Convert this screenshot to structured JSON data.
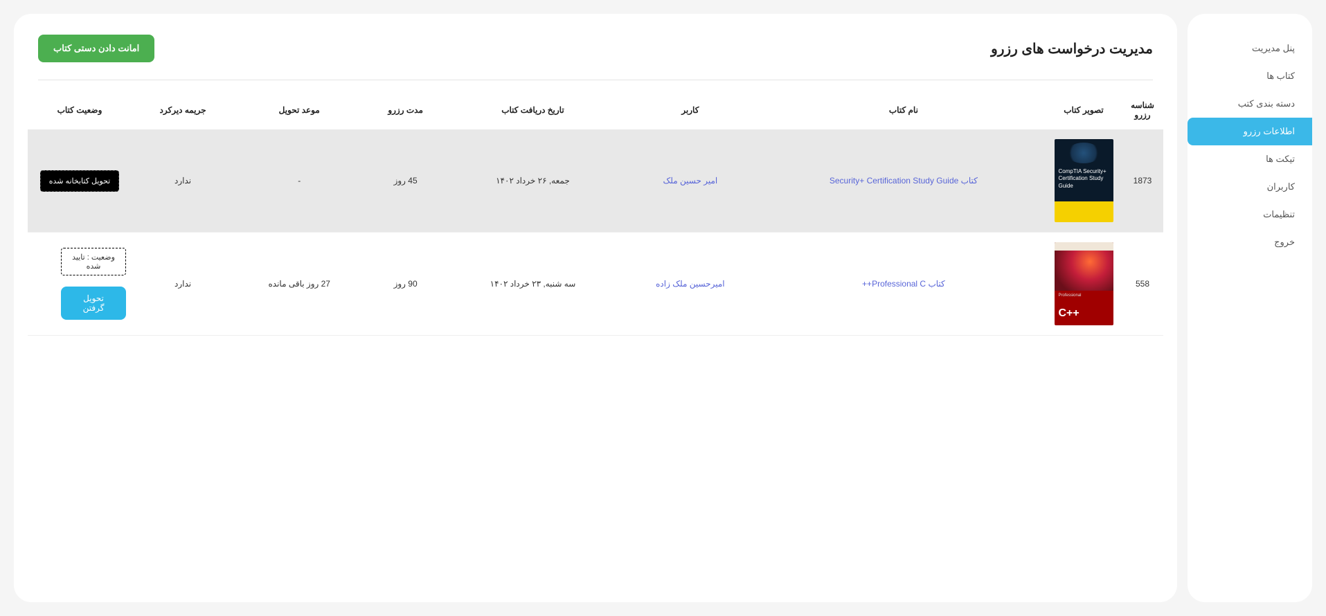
{
  "sidebar": {
    "items": [
      {
        "label": "پنل مدیریت",
        "active": false
      },
      {
        "label": "کتاب ها",
        "active": false
      },
      {
        "label": "دسته بندی کتب",
        "active": false
      },
      {
        "label": "اطلاعات رزرو",
        "active": true
      },
      {
        "label": "تیکت ها",
        "active": false
      },
      {
        "label": "کاربران",
        "active": false
      },
      {
        "label": "تنظیمات",
        "active": false
      },
      {
        "label": "خروج",
        "active": false
      }
    ]
  },
  "header": {
    "title": "مدیریت درخواست های رزرو",
    "manual_lend_label": "امانت دادن دستی کتاب"
  },
  "table": {
    "columns": {
      "reserve_id": "شناسه رزرو",
      "book_image": "تصویر کتاب",
      "book_name": "نام کتاب",
      "user": "کاربر",
      "receive_date": "تاریخ دریافت کتاب",
      "reserve_duration": "مدت رزرو",
      "due_date": "موعد تحویل",
      "late_fee": "جریمه دیرکرد",
      "status": "وضعیت کتاب"
    },
    "rows": [
      {
        "id": "1873",
        "cover_title": "CompTIA Security+ Certification Study Guide",
        "book_name": "کتاب Security+ Certification Study Guide",
        "user": "امیر حسین ملک",
        "receive_date": "جمعه, ۲۶ خرداد ۱۴۰۲",
        "duration": "45 روز",
        "due": "-",
        "late_fee": "ندارد",
        "status_label": "تحویل کتابخانه شده"
      },
      {
        "id": "558",
        "cover_title": "C++",
        "cover_sub": "Professional",
        "book_name": "کتاب Professional C++",
        "user": "امیرحسین ملک زاده",
        "receive_date": "سه شنبه, ۲۳ خرداد ۱۴۰۲",
        "duration": "90 روز",
        "due": "27 روز باقی مانده",
        "late_fee": "ندارد",
        "status_prefix": "وضعیت : تایید شده",
        "receive_btn": "تحویل گرفتن"
      }
    ]
  }
}
